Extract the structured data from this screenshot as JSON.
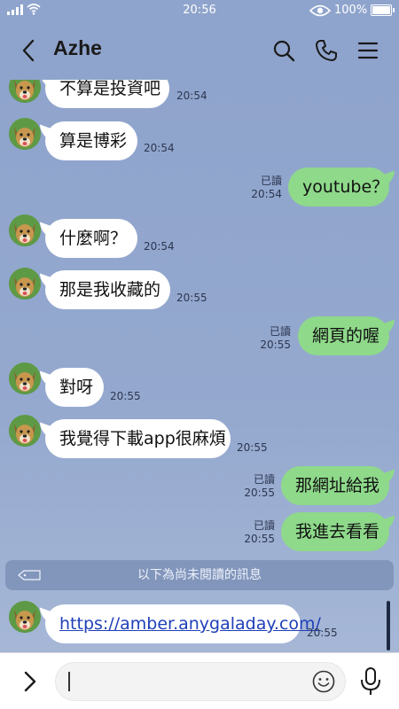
{
  "status_bar": {
    "time": "20:56",
    "battery": "100%"
  },
  "header": {
    "title": "Azhe"
  },
  "icons": {
    "back": "chevron-left-icon",
    "search": "search-icon",
    "call": "phone-icon",
    "menu": "menu-icon",
    "expand": "chevron-right-icon",
    "emoji": "emoji-icon",
    "mic": "microphone-icon",
    "unread_tag": "tag-icon"
  },
  "colors": {
    "background": "#8fa4cc",
    "outgoing_bubble": "#8ed98a",
    "incoming_bubble": "#ffffff",
    "link": "#1f3fb8"
  },
  "messages": [
    {
      "dir": "in",
      "text": "不算是投資吧",
      "time": "20:54"
    },
    {
      "dir": "in",
      "text": "算是博彩",
      "time": "20:54"
    },
    {
      "dir": "out",
      "text": "youtube？",
      "time": "20:54",
      "read": "已讀"
    },
    {
      "dir": "in",
      "text": "什麼啊？",
      "time": "20:54"
    },
    {
      "dir": "in",
      "text": "那是我收藏的",
      "time": "20:55"
    },
    {
      "dir": "out",
      "text": "網頁的喔",
      "time": "20:55",
      "read": "已讀"
    },
    {
      "dir": "in",
      "text": "對呀",
      "time": "20:55"
    },
    {
      "dir": "in",
      "text": "我覺得下載app很麻煩",
      "time": "20:55"
    },
    {
      "dir": "out",
      "text": "那網址給我",
      "time": "20:55",
      "read": "已讀"
    },
    {
      "dir": "out",
      "text": "我進去看看",
      "time": "20:55",
      "read": "已讀"
    },
    {
      "dir": "in",
      "text": "https://amber.anygaladay.com/",
      "time": "20:55",
      "link": true
    }
  ],
  "unread_divider": "以下為尚未閱讀的訊息",
  "input": {
    "value": ""
  }
}
